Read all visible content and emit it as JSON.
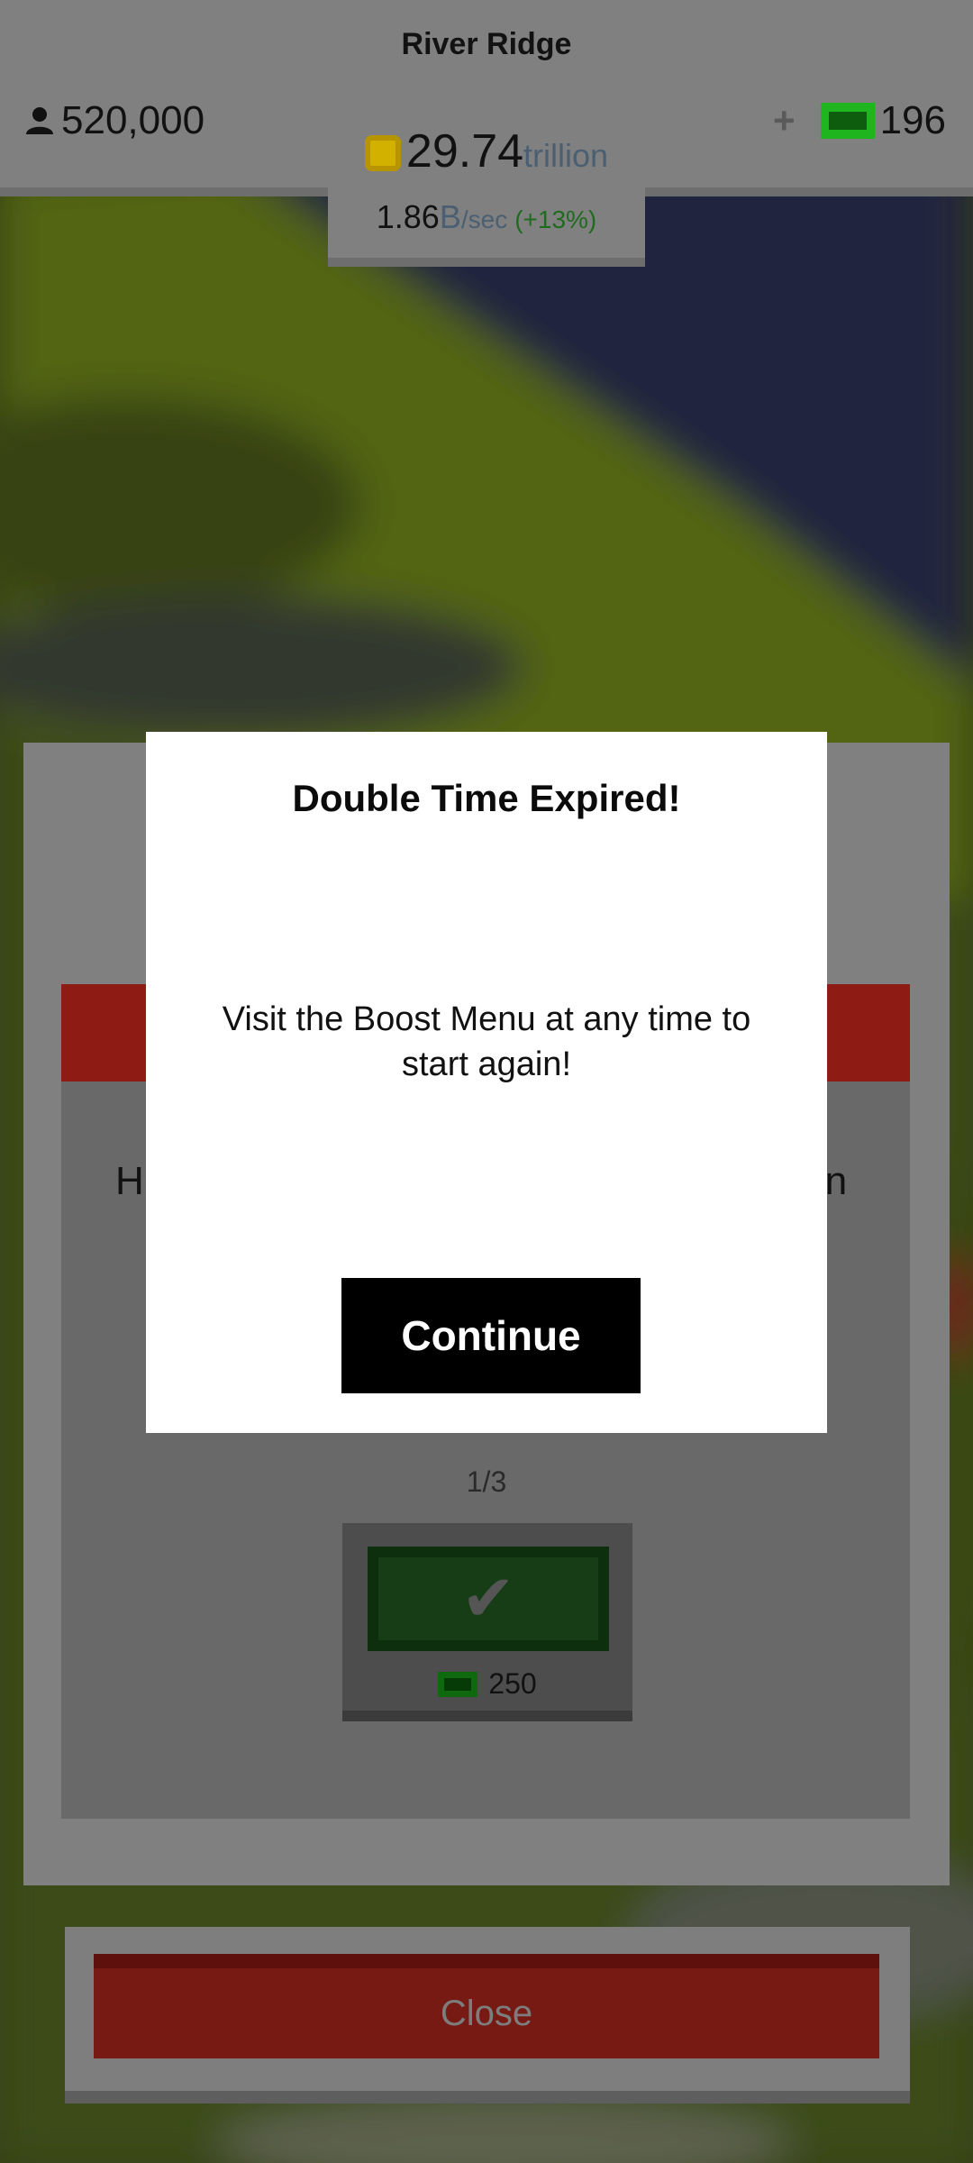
{
  "hud": {
    "city_name": "River Ridge",
    "population": "520,000",
    "cash_plus": "+",
    "cash_amount": "196",
    "money_value": "29.74",
    "money_unit": "trillion",
    "rate_value": "1.86",
    "rate_suffix": "B",
    "rate_unit": "/sec",
    "rate_bonus": "(+13%)"
  },
  "background_dialog": {
    "partial_text_left": "H",
    "partial_text_right": "in",
    "page_indicator": "1/3",
    "price": "250",
    "close_label": "Close"
  },
  "modal": {
    "title": "Double Time Expired!",
    "body": "Visit the Boost Menu at any time to start again!",
    "continue_label": "Continue"
  },
  "icons": {
    "population": "person-icon",
    "coin": "coin-icon",
    "cash": "cash-bill-icon",
    "check": "checkmark-icon"
  },
  "colors": {
    "hud_gray": "#808080",
    "modal_bg": "#ffffff",
    "button_black": "#000000",
    "close_red": "#771a14",
    "cash_green": "#1fb51f",
    "coin_gold": "#d3b100"
  }
}
